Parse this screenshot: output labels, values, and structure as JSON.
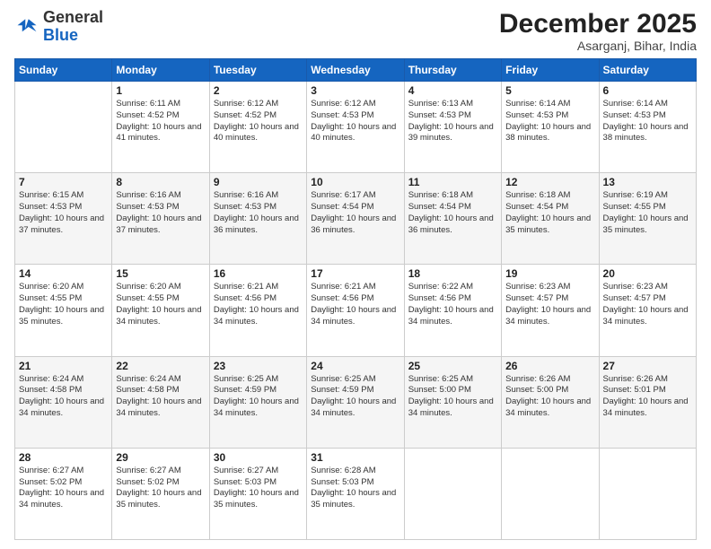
{
  "header": {
    "logo_general": "General",
    "logo_blue": "Blue",
    "month_title": "December 2025",
    "location": "Asarganj, Bihar, India"
  },
  "days_of_week": [
    "Sunday",
    "Monday",
    "Tuesday",
    "Wednesday",
    "Thursday",
    "Friday",
    "Saturday"
  ],
  "weeks": [
    [
      {
        "day": "",
        "info": ""
      },
      {
        "day": "1",
        "info": "Sunrise: 6:11 AM\nSunset: 4:52 PM\nDaylight: 10 hours and 41 minutes."
      },
      {
        "day": "2",
        "info": "Sunrise: 6:12 AM\nSunset: 4:52 PM\nDaylight: 10 hours and 40 minutes."
      },
      {
        "day": "3",
        "info": "Sunrise: 6:12 AM\nSunset: 4:53 PM\nDaylight: 10 hours and 40 minutes."
      },
      {
        "day": "4",
        "info": "Sunrise: 6:13 AM\nSunset: 4:53 PM\nDaylight: 10 hours and 39 minutes."
      },
      {
        "day": "5",
        "info": "Sunrise: 6:14 AM\nSunset: 4:53 PM\nDaylight: 10 hours and 38 minutes."
      },
      {
        "day": "6",
        "info": "Sunrise: 6:14 AM\nSunset: 4:53 PM\nDaylight: 10 hours and 38 minutes."
      }
    ],
    [
      {
        "day": "7",
        "info": "Sunrise: 6:15 AM\nSunset: 4:53 PM\nDaylight: 10 hours and 37 minutes."
      },
      {
        "day": "8",
        "info": "Sunrise: 6:16 AM\nSunset: 4:53 PM\nDaylight: 10 hours and 37 minutes."
      },
      {
        "day": "9",
        "info": "Sunrise: 6:16 AM\nSunset: 4:53 PM\nDaylight: 10 hours and 36 minutes."
      },
      {
        "day": "10",
        "info": "Sunrise: 6:17 AM\nSunset: 4:54 PM\nDaylight: 10 hours and 36 minutes."
      },
      {
        "day": "11",
        "info": "Sunrise: 6:18 AM\nSunset: 4:54 PM\nDaylight: 10 hours and 36 minutes."
      },
      {
        "day": "12",
        "info": "Sunrise: 6:18 AM\nSunset: 4:54 PM\nDaylight: 10 hours and 35 minutes."
      },
      {
        "day": "13",
        "info": "Sunrise: 6:19 AM\nSunset: 4:55 PM\nDaylight: 10 hours and 35 minutes."
      }
    ],
    [
      {
        "day": "14",
        "info": "Sunrise: 6:20 AM\nSunset: 4:55 PM\nDaylight: 10 hours and 35 minutes."
      },
      {
        "day": "15",
        "info": "Sunrise: 6:20 AM\nSunset: 4:55 PM\nDaylight: 10 hours and 34 minutes."
      },
      {
        "day": "16",
        "info": "Sunrise: 6:21 AM\nSunset: 4:56 PM\nDaylight: 10 hours and 34 minutes."
      },
      {
        "day": "17",
        "info": "Sunrise: 6:21 AM\nSunset: 4:56 PM\nDaylight: 10 hours and 34 minutes."
      },
      {
        "day": "18",
        "info": "Sunrise: 6:22 AM\nSunset: 4:56 PM\nDaylight: 10 hours and 34 minutes."
      },
      {
        "day": "19",
        "info": "Sunrise: 6:23 AM\nSunset: 4:57 PM\nDaylight: 10 hours and 34 minutes."
      },
      {
        "day": "20",
        "info": "Sunrise: 6:23 AM\nSunset: 4:57 PM\nDaylight: 10 hours and 34 minutes."
      }
    ],
    [
      {
        "day": "21",
        "info": "Sunrise: 6:24 AM\nSunset: 4:58 PM\nDaylight: 10 hours and 34 minutes."
      },
      {
        "day": "22",
        "info": "Sunrise: 6:24 AM\nSunset: 4:58 PM\nDaylight: 10 hours and 34 minutes."
      },
      {
        "day": "23",
        "info": "Sunrise: 6:25 AM\nSunset: 4:59 PM\nDaylight: 10 hours and 34 minutes."
      },
      {
        "day": "24",
        "info": "Sunrise: 6:25 AM\nSunset: 4:59 PM\nDaylight: 10 hours and 34 minutes."
      },
      {
        "day": "25",
        "info": "Sunrise: 6:25 AM\nSunset: 5:00 PM\nDaylight: 10 hours and 34 minutes."
      },
      {
        "day": "26",
        "info": "Sunrise: 6:26 AM\nSunset: 5:00 PM\nDaylight: 10 hours and 34 minutes."
      },
      {
        "day": "27",
        "info": "Sunrise: 6:26 AM\nSunset: 5:01 PM\nDaylight: 10 hours and 34 minutes."
      }
    ],
    [
      {
        "day": "28",
        "info": "Sunrise: 6:27 AM\nSunset: 5:02 PM\nDaylight: 10 hours and 34 minutes."
      },
      {
        "day": "29",
        "info": "Sunrise: 6:27 AM\nSunset: 5:02 PM\nDaylight: 10 hours and 35 minutes."
      },
      {
        "day": "30",
        "info": "Sunrise: 6:27 AM\nSunset: 5:03 PM\nDaylight: 10 hours and 35 minutes."
      },
      {
        "day": "31",
        "info": "Sunrise: 6:28 AM\nSunset: 5:03 PM\nDaylight: 10 hours and 35 minutes."
      },
      {
        "day": "",
        "info": ""
      },
      {
        "day": "",
        "info": ""
      },
      {
        "day": "",
        "info": ""
      }
    ]
  ]
}
